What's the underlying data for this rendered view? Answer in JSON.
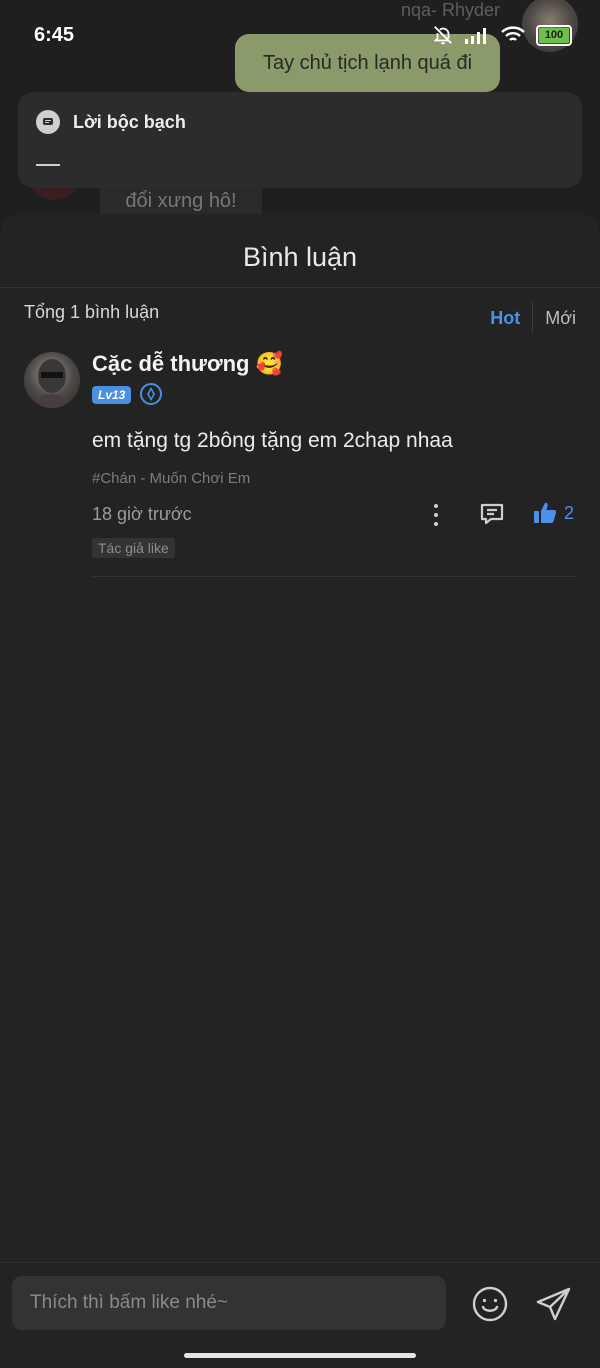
{
  "status_bar": {
    "time": "6:45",
    "battery": "100"
  },
  "background_chat": {
    "sender_name": "nqa- Rhyder",
    "bubble_text": "Tay chủ tịch lạnh quá đi",
    "partial_text": "đổi xưng hô!"
  },
  "notice": {
    "title": "Lời bộc bạch"
  },
  "comments_sheet": {
    "title": "Bình luận",
    "total": "Tổng 1 bình luận",
    "sort_hot": "Hot",
    "sort_new": "Mới",
    "active_sort": "Hot",
    "accent_color": "#4d90ea"
  },
  "comments": [
    {
      "username": "Cặc dễ thương 🥰",
      "level": "Lv13",
      "text": "em tặng tg 2bông tặng em 2chap nhaa",
      "tag": "#Chán - Muốn Chơi Em",
      "time": "18 giờ trước",
      "likes": "2",
      "author_like": "Tác giả like"
    }
  ],
  "input": {
    "placeholder": "Thích thì bấm like nhé~",
    "value": ""
  },
  "icons": {
    "notice": "message-icon",
    "more": "more-vertical-icon",
    "reply": "comment-icon",
    "like": "thumbs-up-icon",
    "emoji": "emoji-icon",
    "send": "send-icon"
  }
}
